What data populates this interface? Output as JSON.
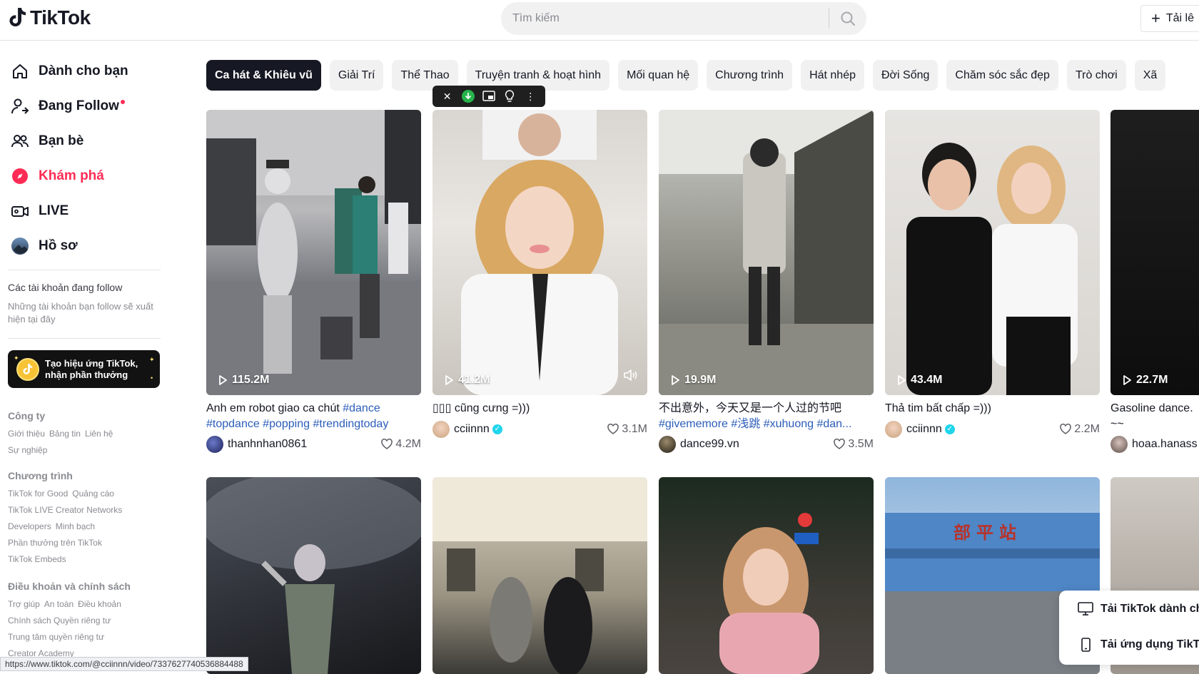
{
  "header": {
    "logo_text": "TikTok",
    "search_placeholder": "Tìm kiếm",
    "upload_label": "Tải lê"
  },
  "sidebar": {
    "nav": [
      {
        "label": "Dành cho bạn",
        "icon": "home-icon"
      },
      {
        "label": "Đang Follow",
        "icon": "following-icon"
      },
      {
        "label": "Bạn bè",
        "icon": "friends-icon"
      },
      {
        "label": "Khám phá",
        "icon": "explore-icon"
      },
      {
        "label": "LIVE",
        "icon": "live-icon"
      },
      {
        "label": "Hồ sơ",
        "icon": "profile-avatar-icon"
      }
    ],
    "following_title": "Các tài khoản đang follow",
    "following_desc": "Những tài khoản bạn follow sẽ xuất hiện tại đây",
    "effect_card": "Tạo hiệu ứng TikTok, nhận phần thưởng",
    "sections": [
      {
        "title": "Công ty",
        "links": [
          "Giới thiệu",
          "Bảng tin",
          "Liên hệ",
          "Sự nghiệp"
        ]
      },
      {
        "title": "Chương trình",
        "links": [
          "TikTok for Good",
          "Quảng cáo",
          "TikTok LIVE Creator Networks",
          "Developers",
          "Minh bạch",
          "Phần thưởng trên TikTok",
          "TikTok Embeds"
        ]
      },
      {
        "title": "Điều khoản và chính sách",
        "links": [
          "Trợ giúp",
          "An toàn",
          "Điều khoản",
          "Chính sách Quyền riêng tư",
          "Trung tâm quyền riêng tư",
          "Creator Academy"
        ]
      }
    ]
  },
  "categories": [
    "Ca hát & Khiêu vũ",
    "Giải Trí",
    "Thể Thao",
    "Truyện tranh & hoạt hình",
    "Mối quan hệ",
    "Chương trình",
    "Hát nhép",
    "Đời Sống",
    "Chăm sóc sắc đẹp",
    "Trò chơi",
    "Xã"
  ],
  "videos": [
    {
      "views": "115.2M",
      "desc": "Anh em robot giao ca chút ",
      "tags": "#dance #topdance #popping #trendingtoday",
      "user": "thanhnhan0861",
      "verified": false,
      "likes": "4.2M"
    },
    {
      "views": "41.2M",
      "desc": "▯▯▯ cũng cưng =)))",
      "tags": "",
      "user": "cciinnn",
      "verified": true,
      "likes": "3.1M"
    },
    {
      "views": "19.9M",
      "desc": "不出意外，今天又是一个人过的节吧 ",
      "tags": "#givememore #浅跳 #xuhuong #dan...",
      "user": "dance99.vn",
      "verified": false,
      "likes": "3.5M"
    },
    {
      "views": "43.4M",
      "desc": "Thả tim bất chấp =)))",
      "tags": "",
      "user": "cciinnn",
      "verified": true,
      "likes": "2.2M"
    },
    {
      "views": "22.7M",
      "desc": "Gasoline dance. ~~",
      "tags": "",
      "user": "hoaa.hanass",
      "verified": false,
      "likes": ""
    }
  ],
  "second_row_overlay": "部平站",
  "download_popup": {
    "desktop": "Tải TikTok dành ch",
    "mobile": "Tải ứng dụng TikTo"
  },
  "status_url": "https://www.tiktok.com/@cciinnn/video/7337627740536884488",
  "colors": {
    "accent": "#fe2c55",
    "tag": "#2b5db9",
    "verified": "#20d5ec"
  }
}
